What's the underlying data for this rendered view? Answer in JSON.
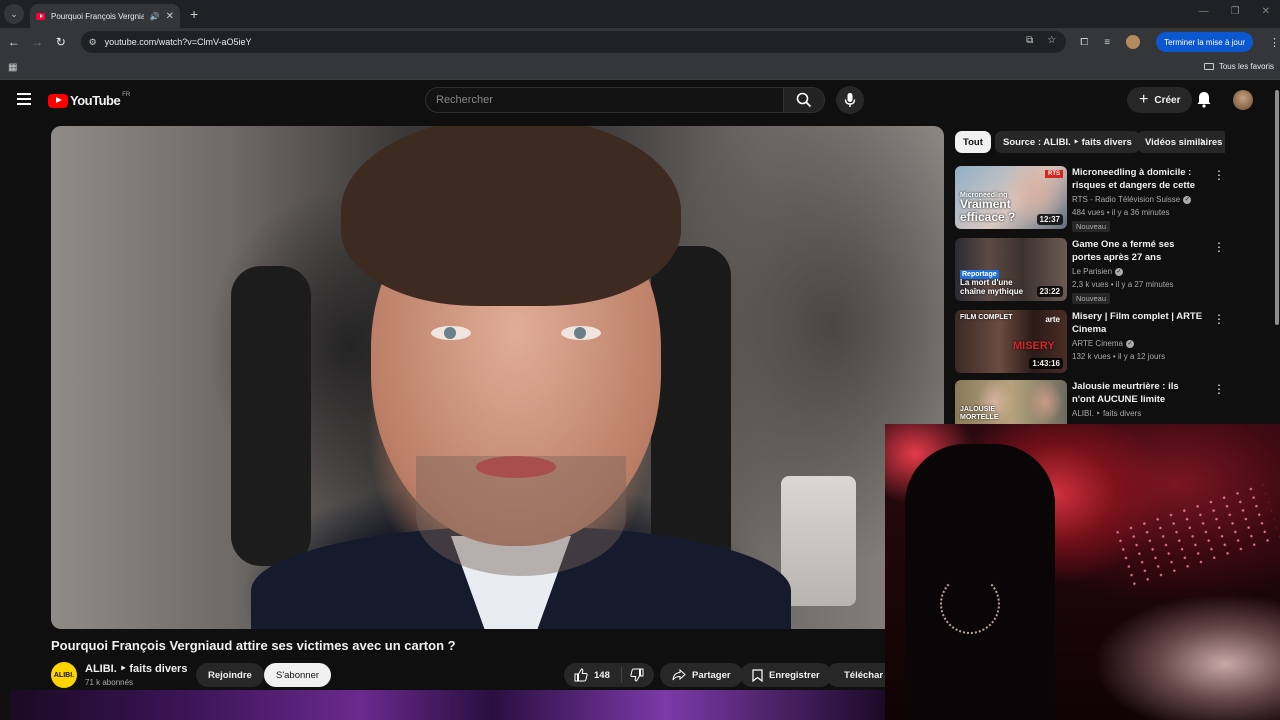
{
  "browser": {
    "tab_title": "Pourquoi François Vergniaud attire ses victimes avec un carton ?",
    "url": "youtube.com/watch?v=ClmV-aO5ieY",
    "update_button": "Terminer la mise à jour",
    "bookmarks_all": "Tous les favoris"
  },
  "youtube": {
    "logo": "YouTube",
    "region": "FR",
    "search_placeholder": "Rechercher",
    "create_label": "Créer"
  },
  "video": {
    "title": "Pourquoi François Vergniaud attire ses victimes avec un carton ?",
    "channel_avatar_text": "ALIBI.",
    "channel_name": "ALIBI. ‣ faits divers",
    "subscribers": "71 k abonnés",
    "join_label": "Rejoindre",
    "subscribe_label": "S'abonner",
    "likes": "148",
    "share_label": "Partager",
    "save_label": "Enregistrer",
    "download_label": "Téléchar"
  },
  "chips": [
    "Tout",
    "Source : ALIBI. ‣ faits divers",
    "Vidéos similaires"
  ],
  "recommendations": [
    {
      "title": "Microneedling à domicile : risques et dangers de cette ...",
      "channel": "RTS - Radio Télévision Suisse",
      "meta": "484 vues • il y a 36 minutes",
      "badge": "Nouveau",
      "duration": "12:37",
      "thumb_text": "Vraiment efficace ?",
      "thumb_small": "Microneedling",
      "thumb_badge": "RTS"
    },
    {
      "title": "Game One a fermé ses portes après 27 ans d'émissions ...",
      "channel": "Le Parisien",
      "meta": "2,3 k vues • il y a 27 minutes",
      "badge": "Nouveau",
      "duration": "23:22",
      "thumb_text": "La mort d'une chaîne mythique",
      "thumb_small": "Reportage"
    },
    {
      "title": "Misery | Film complet | ARTE Cinema",
      "channel": "ARTE Cinema",
      "meta": "132 k vues • il y a 12 jours",
      "duration": "1:43:16",
      "thumb_text": "MISERY",
      "thumb_small": "FILM COMPLET",
      "thumb_badge": "arte"
    },
    {
      "title": "Jalousie meurtrière : ils n'ont AUCUNE limite",
      "channel": "ALIBI. ‣ faits divers",
      "thumb_text": "JALOUSIE MORTELLE"
    }
  ]
}
